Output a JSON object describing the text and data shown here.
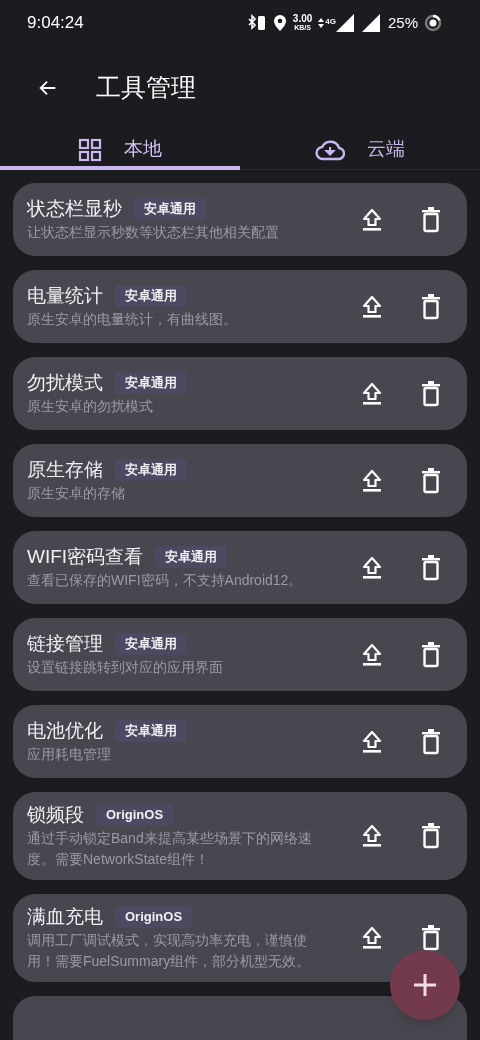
{
  "status_bar": {
    "time": "9:04:24",
    "net_speed": "3.00",
    "net_unit": "KB/S",
    "network": "4G",
    "battery": "25%"
  },
  "header": {
    "title": "工具管理"
  },
  "tabs": [
    {
      "label": "本地",
      "selected": true
    },
    {
      "label": "云端",
      "selected": false
    }
  ],
  "tools": [
    {
      "name": "状态栏显秒",
      "tag": "安卓通用",
      "description": "让状态栏显示秒数等状态栏其他相关配置"
    },
    {
      "name": "电量统计",
      "tag": "安卓通用",
      "description": "原生安卓的电量统计，有曲线图。"
    },
    {
      "name": "勿扰模式",
      "tag": "安卓通用",
      "description": "原生安卓的勿扰模式"
    },
    {
      "name": "原生存储",
      "tag": "安卓通用",
      "description": "原生安卓的存储"
    },
    {
      "name": "WIFI密码查看",
      "tag": "安卓通用",
      "description": "查看已保存的WIFI密码，不支持Android12。"
    },
    {
      "name": "链接管理",
      "tag": "安卓通用",
      "description": "设置链接跳转到对应的应用界面"
    },
    {
      "name": "电池优化",
      "tag": "安卓通用",
      "description": "应用耗电管理"
    },
    {
      "name": "锁频段",
      "tag": "OriginOS",
      "description": "通过手动锁定Band来提高某些场景下的网络速度。需要NetworkState组件！"
    },
    {
      "name": "满血充电",
      "tag": "OriginOS",
      "description": "调用工厂调试模式，实现高功率充电，谨慎使用！需要FuelSummary组件，部分机型无效。"
    }
  ],
  "more_below": true
}
